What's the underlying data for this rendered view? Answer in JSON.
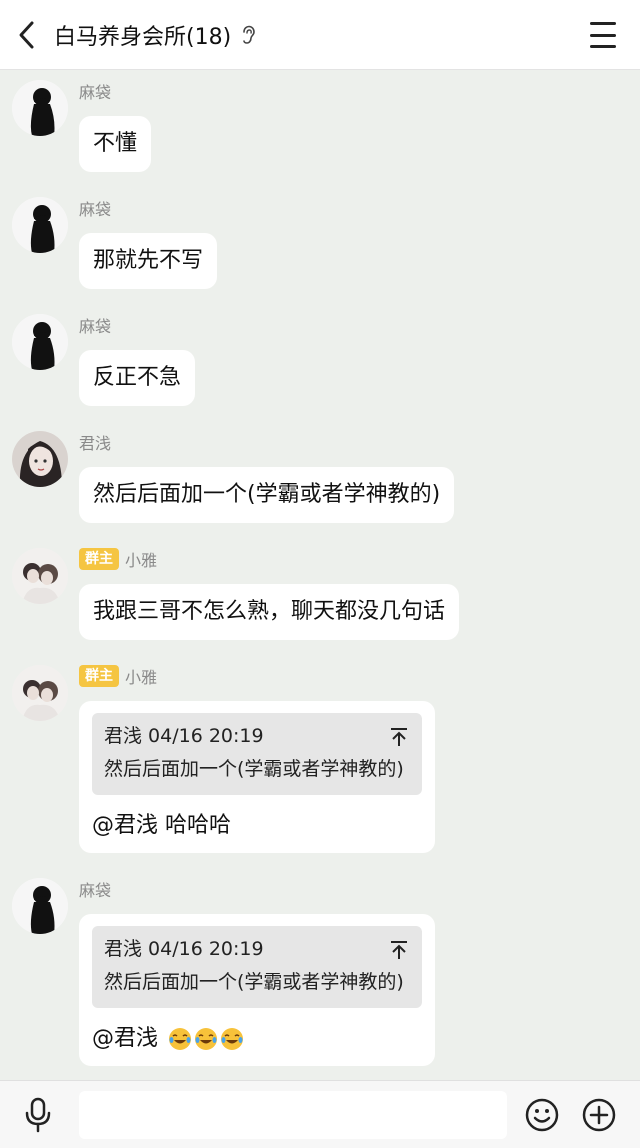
{
  "header": {
    "title": "白马养身会所(18)",
    "back_icon": "chevron-left-icon",
    "ear_icon": "ear-icon",
    "menu_icon": "hamburger-menu-icon"
  },
  "messages": [
    {
      "sender": "麻袋",
      "badge": "",
      "text": "不懂"
    },
    {
      "sender": "麻袋",
      "badge": "",
      "text": "那就先不写"
    },
    {
      "sender": "麻袋",
      "badge": "",
      "text": "反正不急"
    },
    {
      "sender": "君浅",
      "badge": "",
      "text": "然后后面加一个(学霸或者学神教的)"
    },
    {
      "sender": "小雅",
      "badge": "群主",
      "text": "我跟三哥不怎么熟，聊天都没几句话"
    },
    {
      "sender": "小雅",
      "badge": "群主",
      "quote": {
        "author_time": "君浅 04/16 20:19",
        "text": "然后后面加一个(学霸或者学神教的)"
      },
      "text": "@君浅 哈哈哈"
    },
    {
      "sender": "麻袋",
      "badge": "",
      "quote": {
        "author_time": "君浅 04/16 20:19",
        "text": "然后后面加一个(学霸或者学神教的)"
      },
      "text": "@君浅",
      "emojis": [
        "tears-of-joy-emoji",
        "tears-of-joy-emoji",
        "tears-of-joy-emoji"
      ]
    }
  ],
  "input_bar": {
    "mic_icon": "microphone-icon",
    "emoji_icon": "smiley-icon",
    "plus_icon": "plus-circle-icon"
  },
  "colors": {
    "background": "#edf0ec",
    "bubble": "#ffffff",
    "badge": "#f5c542",
    "quote_bg": "#e6e6e6"
  }
}
